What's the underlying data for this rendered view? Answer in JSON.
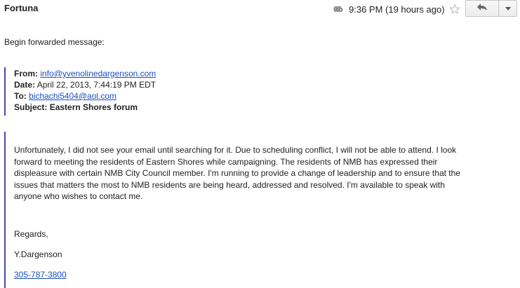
{
  "header": {
    "sender": "Fortuna",
    "timestamp": "9:36 PM (19 hours ago)",
    "icons": [
      "paperclip-icon",
      "star-icon",
      "reply-icon",
      "chevron-down-icon"
    ]
  },
  "message": {
    "forward_intro": "Begin forwarded message:",
    "fields": {
      "from_label": "From:",
      "from_value": "info@yvenolinedargenson.com",
      "date_label": "Date:",
      "date_value": "April 22, 2013, 7:44:19 PM EDT",
      "to_label": "To:",
      "to_value": "bichachi5404@aol.com",
      "subject_label": "Subject:",
      "subject_value": "Eastern Shores forum"
    },
    "body_lines": [
      "Unfortunately, I did not see your email until searching for it.  Due to scheduling conflict, I will not be able to attend. I look",
      "forward to meeting the residents of Eastern Shores while campaigning.  The residents of NMB has expressed their",
      "displeasure with certain NMB City Council member.  I'm running to provide a change of leadership and to ensure that the",
      "issues that matters the most to NMB residents are being heard, addressed and resolved. I'm available to speak with",
      "anyone who wishes to contact me."
    ],
    "regards": "Regards,",
    "signature": "Y.Dargenson",
    "phone": "305-787-3800"
  }
}
